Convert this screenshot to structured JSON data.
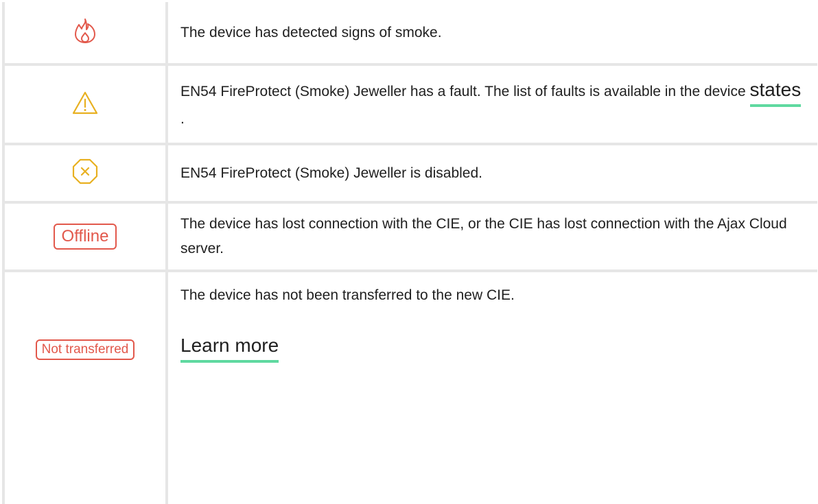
{
  "rows": [
    {
      "icon": "fire-icon",
      "icon_color": "#e2584b",
      "text": "The device has detected signs of smoke."
    },
    {
      "icon": "warning-triangle-icon",
      "icon_color": "#e8b020",
      "text_before": "EN54 FireProtect (Smoke) Jeweller has a fault. The list of faults is available in the device ",
      "link": "states",
      "text_after": "."
    },
    {
      "icon": "disabled-octagon-icon",
      "icon_color": "#e8b020",
      "text": "EN54 FireProtect (Smoke) Jeweller is disabled."
    },
    {
      "badge": "Offline",
      "badge_color": "#e2584b",
      "text": "The device has lost connection with the CIE, or the CIE has lost connection with the Ajax Cloud server."
    },
    {
      "badge": "Not transferred",
      "badge_color": "#e2584b",
      "text": "The device has not been transferred to the new CIE.",
      "link": "Learn more"
    }
  ],
  "link_underline_color": "#5fd9a0"
}
